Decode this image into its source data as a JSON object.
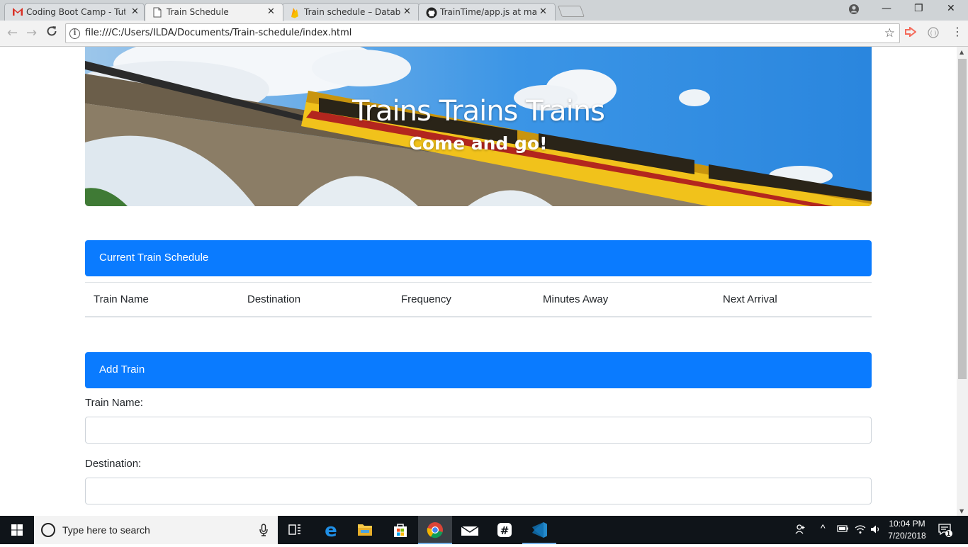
{
  "browser": {
    "tabs": [
      {
        "title": "Coding Boot Camp - Tuto",
        "icon": "gmail-icon"
      },
      {
        "title": "Train Schedule",
        "icon": "page-icon"
      },
      {
        "title": "Train schedule – Databas",
        "icon": "firebase-icon"
      },
      {
        "title": "TrainTime/app.js at maste",
        "icon": "github-icon"
      }
    ],
    "url": "file:///C:/Users/ILDA/Documents/Train-schedule/index.html"
  },
  "page": {
    "jumbotron": {
      "title": "Trains Trains Trains",
      "subtitle": "Come and go!"
    },
    "schedule": {
      "header": "Current Train Schedule",
      "columns": [
        "Train Name",
        "Destination",
        "Frequency",
        "Minutes Away",
        "Next Arrival"
      ]
    },
    "add_train": {
      "header": "Add Train",
      "fields": [
        {
          "label": "Train Name:",
          "value": ""
        },
        {
          "label": "Destination:",
          "value": ""
        }
      ]
    }
  },
  "taskbar": {
    "search_placeholder": "Type here to search",
    "time": "10:04 PM",
    "date": "7/20/2018",
    "notification_count": "1"
  },
  "colors": {
    "primary": "#0a7bff",
    "train_yellow": "#f4c20d",
    "sky": "#2f8fe0"
  }
}
